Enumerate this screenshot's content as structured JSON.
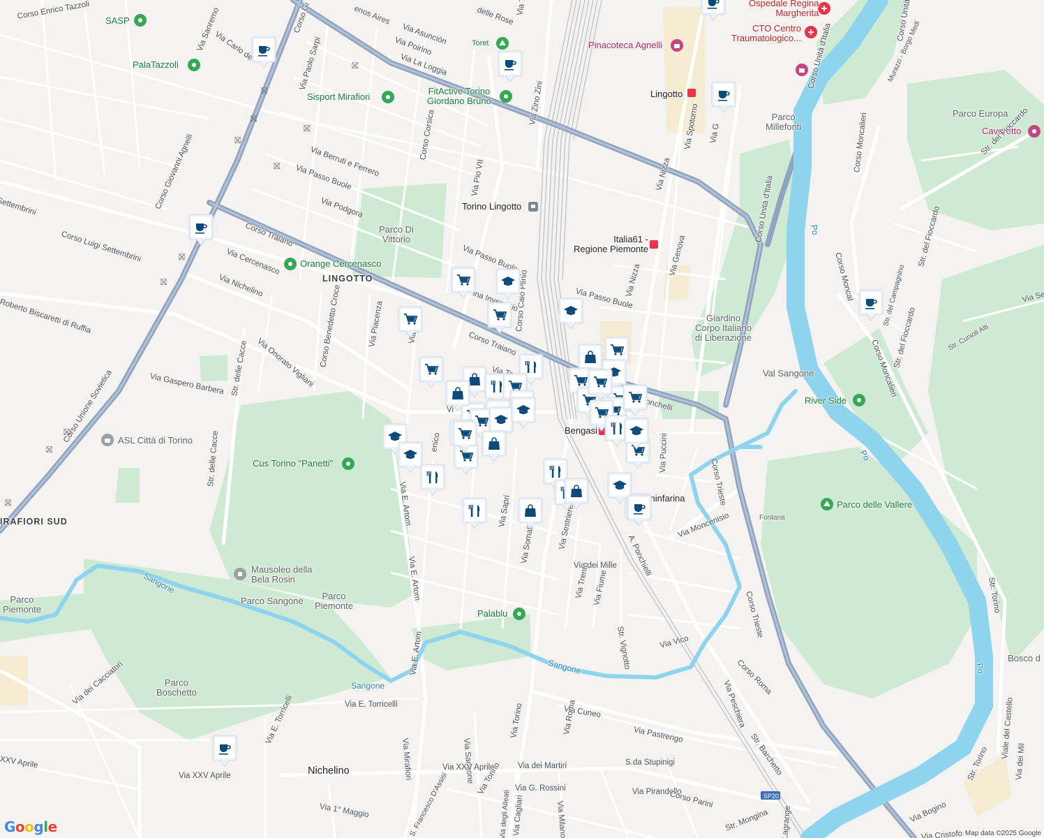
{
  "map": {
    "attribution": "Map data ©2025 Google",
    "logo": "Google",
    "colors": {
      "pin": "#0b4a7a",
      "pin_border": "#ffffff",
      "water": "#8ed4ef",
      "highway": "#8fa4c0",
      "park": "#ccebd0",
      "metro": "#e8334a"
    }
  },
  "labels": {
    "districts": {
      "lingotto": "LINGOTTO",
      "mirafiori_sud": "IRAFIORI SUD",
      "nichelino": "Nichelino"
    },
    "areas": {
      "parco_di_vittorio": "Parco Di\nVittorio",
      "parco_piemonte_w": "Parco\nPiemonte",
      "parco_sangone": "Parco Sangone",
      "parco_piemonte_c": "Parco\nPiemonte",
      "parco_boschetto": "Parco\nBoschetto",
      "parco_millefonti": "Parco\nMillefonti",
      "parco_europa": "Parco Europa",
      "giardino": "Giardino\nCorpo Italiano\ndi Liberazione",
      "val_sangone": "Val Sangone",
      "fontana": "Fontana",
      "bosco": "Bosco d"
    },
    "water": {
      "sangone_1": "Sangone",
      "sangone_2": "Sangone",
      "sangone_3": "Sangone",
      "po_1": "Po",
      "po_2": "Po",
      "po_3": "Po"
    },
    "pois": {
      "sasp": "SASP",
      "palatazzoli": "PalaTazzoli",
      "sisport": "Sisport Mirafiori",
      "fitactive": "FitActive Torino\nGiordano Bruno",
      "toret": "Toret",
      "pinacoteca": "Pinacoteca Agnelli",
      "ospedale": "Ospedale Regina\nMargherita",
      "cto": "CTO Centro\nTraumatologico...",
      "cavoretto": "Cavoretto",
      "orange": "Orange Cercenasco",
      "asl": "ASL Città di Torino",
      "cus": "Cus Torino \"Panetti\"",
      "mausoleo": "Mausoleo della\nBela Rosin",
      "palablu": "Palablu",
      "river_side": "River Side",
      "parco_vallere": "Parco delle Vallere"
    },
    "transit": {
      "torino_lingotto": "Torino Lingotto",
      "lingotto_metro": "Lingotto",
      "italia61": "Italia61 -\nRegione Piemonte",
      "bengasi": "Bengasi",
      "pininfarina": "Pininfarina",
      "sp20": "SP20"
    },
    "roads": {
      "corso_enrico_tazzoli": "Corso Enrico Tazzoli",
      "via_sanremo": "Via Sanremo",
      "via_carlo": "Via Carlo de",
      "corso_giovanni_agnelli": "Corso Giovanni Agnelli",
      "corso_g_top": "Corso Gi",
      "via_paolo_sarpi": "Via Paolo Sarpi",
      "buenos_aires": "enos Aires",
      "via_asuncion": "Via Asunción",
      "via_poirino": "Via Poirino",
      "via_la_loggia": "Via La Loggia",
      "delle_rose": "delle Rose",
      "corso_corsica": "Corso Corsica",
      "via_pio_vii": "Via Pio VII",
      "via_zino_zini": "Via Zino Zini",
      "via_berruti": "Via Berruti e Ferrero",
      "via_passo_buole_1": "Via Passo Buole",
      "via_podgora": "Via Podgora",
      "settembrini_1": "Settembrini",
      "corso_luigi_settembrini": "Corso Luigi Settembrini",
      "corso_traiano_1": "Corso Traiano",
      "via_cercenasco": "Via Cercenasco",
      "via_nichelino": "Via Nichelino",
      "roberto_biscaretti": "Roberto Biscaretti di Ruffia",
      "via_onorato_vigliani": "Via Onorato Vigliani",
      "str_delle_cacce_1": "Str. delle Cacce",
      "corso_benedetto_croce": "Corso Benedetto Croce",
      "via_piacenza": "Via Piacenza",
      "via_pio_2": "Via Pio",
      "corso_unione_sovietica": "Corso Unione Sovietica",
      "via_gaspero_barbera": "Via Gaspero Barbera",
      "via_passo_buole_2": "Via Passo Buole",
      "via_passo_buole_3": "Via Passo Buole",
      "corso_traiano_2": "Corso Traiano",
      "corso_caio_plinio": "Corso Caio Plinio",
      "via_ton": "Via Ton",
      "ina_invernizio": "ina Invernizio",
      "via_nizza": "Via Nizza",
      "via_nizza_2": "Via Nizza",
      "via_genova": "Via Genova",
      "via_spotorno": "Via Spotorno",
      "via_g": "Via G",
      "corso_unita_italia_1": "Corso Unità d'Italia",
      "corso_unita_italia_2": "Corso Unità d'Italia",
      "corso_moncalieri_1": "Corso Moncalieri",
      "corso_moncalieri_2": "Corso Moncal",
      "corso_moncalieri_3": "Corso Moncalieri",
      "str_del_fioccardo_1": "Str. del Fioccardo",
      "str_del_fioccardo_2": "Str. del Fioccardo",
      "str_del_fioccardo_3": "Str. del Fioccardo",
      "str_campagnino": "Str. del Campagnino",
      "str_cunioli_alti": "Str. Cunioli Alti",
      "via_se": "Via Se",
      "murazzi": "Murazzi - Borgo Medi",
      "ponchielli": "Ponchelli",
      "corso_trieste_1": "Corso Trieste",
      "corso_trieste_2": "Corso Trieste",
      "via_puccini": "Via Puccini",
      "via_moncenisio": "Via Moncenisio",
      "a_ponchielli": "A. Ponchielli",
      "via_e_artom_1": "Via E. Artom",
      "via_e_artom_2": "Via E. Artom",
      "via_e_artom_3": "Via E. Artom",
      "str_delle_cacce_2": "Str. delle Cacce",
      "via_sapri": "Via Sapri",
      "via_somalia": "Via Somalia",
      "via_sestriere": "Via Sestriere",
      "via_dei_mille": "Via dei Mille",
      "via_trento": "Via Trento",
      "via_fiume": "Via Fiume",
      "str_vignotto": "Str. Vignotto",
      "via_vico": "Via Vico",
      "corso_roma": "Corso Roma",
      "via_peschiera": "Via Peschiera",
      "str_barchetto": "Str. Barchetto",
      "via_dei_cacciatori": "Via dei Cacciatori",
      "via_e_torricelli_1": "Via E. Torricelli",
      "via_e_torricelli_2": "Via E. Torricelli",
      "via_mirafiori": "Via Mirafiori",
      "via_sangone": "Via Sangone",
      "via_torino_1": "Via Torino",
      "via_torino_2": "Via Torino",
      "via_cuneo": "Via Cuneo",
      "via_roma": "Via Roma",
      "via_pastrengo": "Via Pastrengo",
      "xxv_aprile_1": "XXV Aprile",
      "via_xxv_aprile_1": "Via XXV Aprile",
      "via_xxv_aprile_2": "Via XXV Aprile",
      "via_dei_martiri": "Via dei Martiri",
      "s_da_stupinigi": "S.da Stupinigi",
      "via_g_rossini": "Via G. Rossini",
      "via_pirandello": "Via Pirandello",
      "corso_parini": "Corso Parini",
      "via_1_maggio": "Via 1° Maggio",
      "s_francesco": "S. Francesco D'Assisi",
      "via_degli_alleati": "Via degli Alleati",
      "via_cagliari": "Via Cagliari",
      "via_milano": "Via Milano",
      "str_mongina": "Str. Mongina",
      "lagrange": "Lagrange",
      "via_bogino": "Via Bogino",
      "str_torino_1": "Str. Torino",
      "str_torino_2": "Str. Torino",
      "viale_del_castello": "Viale del Castello",
      "via_dei_mil": "Via dei Mil",
      "via_cristofor": "Via Cristofor",
      "via_ti": "Via T",
      "via_v": "Vi",
      "enico": "enico"
    }
  },
  "markers": [
    {
      "icon": "coffee-icon"
    },
    {
      "icon": "coffee-icon"
    },
    {
      "icon": "coffee-icon"
    },
    {
      "icon": "coffee-icon"
    },
    {
      "icon": "coffee-icon"
    },
    {
      "icon": "coffee-icon"
    },
    {
      "icon": "coffee-icon"
    },
    {
      "icon": "coffee-icon"
    },
    {
      "icon": "cart-icon"
    },
    {
      "icon": "graduation-cap-icon"
    },
    {
      "icon": "cart-icon"
    },
    {
      "icon": "cart-icon"
    },
    {
      "icon": "graduation-cap-icon"
    },
    {
      "icon": "cart-icon"
    },
    {
      "icon": "fork-knife-icon"
    },
    {
      "icon": "shopping-bag-icon"
    },
    {
      "icon": "cart-icon"
    },
    {
      "icon": "shopping-bag-icon"
    },
    {
      "icon": "fork-knife-icon"
    },
    {
      "icon": "cart-icon"
    },
    {
      "icon": "graduation-cap-icon"
    },
    {
      "icon": "cart-icon"
    },
    {
      "icon": "cart-icon"
    },
    {
      "icon": "graduation-cap-icon"
    },
    {
      "icon": "cart-icon"
    },
    {
      "icon": "cart-icon"
    },
    {
      "icon": "shopping-bag-icon"
    },
    {
      "icon": "cart-icon"
    },
    {
      "icon": "graduation-cap-icon"
    },
    {
      "icon": "graduation-cap-icon"
    },
    {
      "icon": "graduation-cap-icon"
    },
    {
      "icon": "fork-knife-icon"
    },
    {
      "icon": "shopping-bag-icon"
    },
    {
      "icon": "fork-knife-icon"
    },
    {
      "icon": "cart-icon"
    },
    {
      "icon": "shopping-bag-icon"
    },
    {
      "icon": "cart-icon"
    },
    {
      "icon": "graduation-cap-icon"
    },
    {
      "icon": "fork-knife-icon"
    },
    {
      "icon": "cart-icon"
    },
    {
      "icon": "cart-icon"
    },
    {
      "icon": "cart-icon"
    },
    {
      "icon": "cart-icon"
    },
    {
      "icon": "cart-icon"
    },
    {
      "icon": "fork-knife-icon"
    },
    {
      "icon": "graduation-cap-icon"
    },
    {
      "icon": "cart-icon"
    },
    {
      "icon": "fork-knife-icon"
    },
    {
      "icon": "shopping-bag-icon"
    },
    {
      "icon": "cart-icon"
    },
    {
      "icon": "graduation-cap-icon"
    },
    {
      "icon": "coffee-icon"
    }
  ]
}
